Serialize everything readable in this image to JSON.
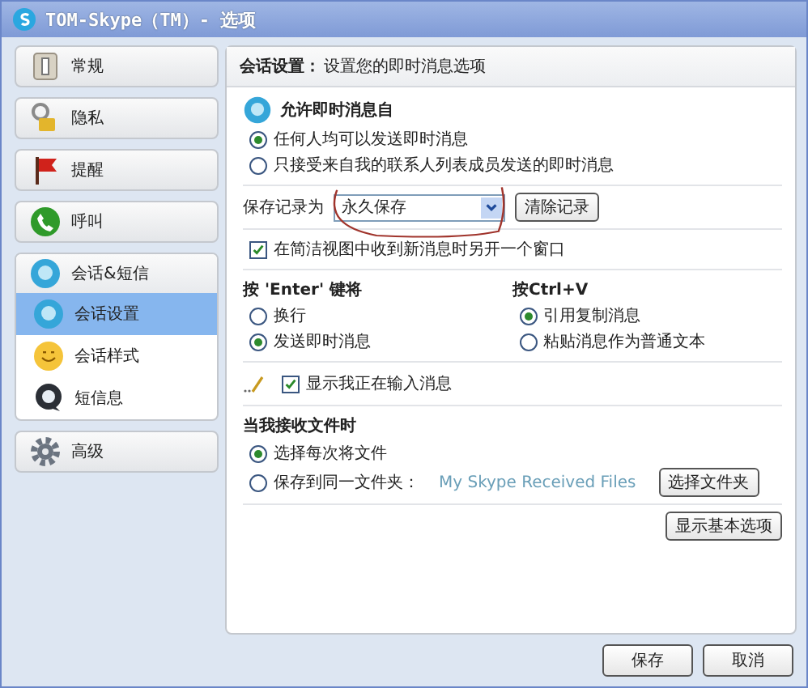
{
  "window": {
    "title": "TOM-Skype（TM）- 选项"
  },
  "sidebar": [
    {
      "label": "常规",
      "kind": "switch",
      "selected": false
    },
    {
      "label": "隐私",
      "kind": "lock",
      "selected": false
    },
    {
      "label": "提醒",
      "kind": "flag",
      "selected": false
    },
    {
      "label": "呼叫",
      "kind": "phone",
      "selected": false
    },
    {
      "label": "会话&短信",
      "kind": "chat",
      "selected": false,
      "children": [
        {
          "label": "会话设置",
          "kind": "chat",
          "selected": true
        },
        {
          "label": "会话样式",
          "kind": "smiley",
          "selected": false
        },
        {
          "label": "短信息",
          "kind": "sms",
          "selected": false
        }
      ]
    },
    {
      "label": "高级",
      "kind": "gear",
      "selected": false
    }
  ],
  "panel": {
    "heading": "会话设置：",
    "description": "设置您的即时消息选项",
    "allow_from": {
      "title": "允许即时消息自",
      "options": [
        {
          "label": "任何人均可以发送即时消息",
          "selected": true
        },
        {
          "label": "只接受来自我的联系人列表成员发送的即时消息",
          "selected": false
        }
      ]
    },
    "history": {
      "label": "保存记录为",
      "value": "永久保存",
      "clear_button": "清除记录"
    },
    "open_window": {
      "label": "在简洁视图中收到新消息时另开一个窗口",
      "checked": true
    },
    "enter_key": {
      "title": "按 'Enter' 键将",
      "options": [
        {
          "label": "换行",
          "selected": false
        },
        {
          "label": "发送即时消息",
          "selected": true
        }
      ]
    },
    "ctrl_v": {
      "title": "按Ctrl+V",
      "options": [
        {
          "label": "引用复制消息",
          "selected": true
        },
        {
          "label": "粘贴消息作为普通文本",
          "selected": false
        }
      ]
    },
    "typing_indicator": {
      "label": "显示我正在输入消息",
      "checked": true
    },
    "receive_files": {
      "title": "当我接收文件时",
      "options": [
        {
          "label": "选择每次将文件",
          "selected": true
        },
        {
          "label": "保存到同一文件夹：",
          "selected": false,
          "folder": "My Skype Received Files",
          "button": "选择文件夹"
        }
      ]
    },
    "basic_button": "显示基本选项"
  },
  "buttons": [
    "保存",
    "取消"
  ]
}
